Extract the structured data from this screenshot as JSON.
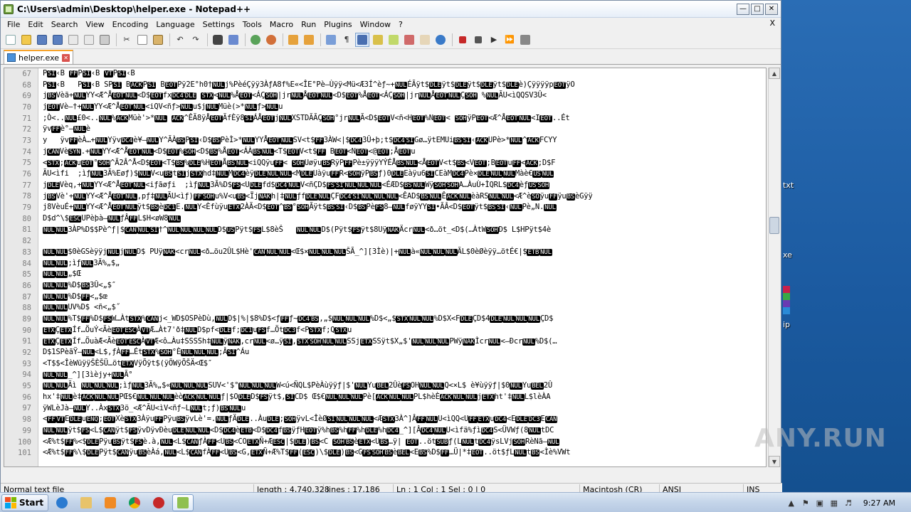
{
  "window": {
    "title": "C:\\Users\\admin\\Desktop\\helper.exe - Notepad++"
  },
  "menu": [
    "File",
    "Edit",
    "Search",
    "View",
    "Encoding",
    "Language",
    "Settings",
    "Tools",
    "Macro",
    "Run",
    "Plugins",
    "Window",
    "?"
  ],
  "menu_close": "X",
  "tab": {
    "label": "helper.exe"
  },
  "lines": [
    {
      "n": "67",
      "t": "PSI‹B FFPSI‹B VTPSI‹B"
    },
    {
      "n": "68",
      "t": "PSI‹B   PSI‹B SPSI BACKPSI BEOTPÿ2E°h0†NULj%PèéÇÿÿ3Àƒ­A8f%E«<ÎE°Pè–Ùÿÿ<Mü<Æ3Í^èƒ~+NULÉÃÿt$DLEÿt$DLEÿt$DLEÿt$DLEè)ÇÿÿÿÿpEOTÿO"
    },
    {
      "n": "69",
      "t": "jBSVèã+NULYY<Æ^ÅEOTNUL<D$EOTfxDC4DLE STX<NUL%ÅEOT<ÁÇSOH|jrNULÅEOTNUL<D$EOT%ÅEOT<ÁÇSOH|jrNULÅEOTNULÇSOH %NULÃU<ìQQSV3Û<"
    },
    {
      "n": "70",
      "t": "jEOTVè–†+NULYY<Æ^ÅEOTNUL<iQV<ñƒ>NULu$jNULMüè(>*NULƒ>NULu"
    },
    {
      "n": "71",
      "t": ";Ò<..NUL£0<..NUL%ACKMüè'>*NUL ACK^ÊÃ8ÿÅEOTÃfÈÿ8SIÁÅEOTjNULXSTDÃÃÇSOH°jrNULÃ<D$EOTV<ñ<HEOT%NEOT< SOHÿPEOT<Æ^ÅEOTNUL<IEOT..Ét"
    },
    {
      "n": "72",
      "t": "ÿvFFè°–NULè"
    },
    {
      "n": "73",
      "t": "y   ÿvFFèÀ…+NULYÿvDC4è¥–NULY^ÃÀBSPSI‹D$BSPèÌ>*NULYYÅEOTNULSV<t$FF3ÀW<|$DC43Û+þ;t$DC4SIGø…ÿtEMUiBSSI‹ACKUPè>*NUL^ACKFCYY"
    },
    {
      "n": "74",
      "t": "jCANVèSYN.+NULYY<Æ^ÅEOTNUL<D$EOT%SOH<D$BS%ÅEOT<ÁÀBSNUL<T$EOTV<t$FF BEOT<NEOT<@EOT;ÅEOTu"
    },
    {
      "n": "75",
      "t": "<STX;ACKuEOT°SOH^Ã2Â^Å<D$EOT<T$BS%DLE%HEOTÅBSNUL<iQQÿuFF< SOHUøÿuBSRÿPFFPè±ÿÿÿYÝÉÅBSNUL<ÅEOTV<t$BS<VEOT;BEOTuFF<ACK;D$F"
    },
    {
      "n": "76",
      "t": "ÃU<ìfi  ;ìƒNUL3Ã%Eøƒ)$NULV<uBStSIjSTXhd‡NULMDC4èÿDLENULNUL<MDLEUàÿuFFR<SOHÿPBSƒ)0DLEEàÿu6SICEàMDC4Pè×DLENULNULMàè€USNUL"
    },
    {
      "n": "77",
      "t": "jDLEVèq,+NULYY<Æ^ÅEOTNUL<iƒãøƒi  ;ìƒNUL3Ã%D$FS<UDLEfd$DC4NULV<ñÇD$FSSINULNULNUL<ÉÆD$BSNULWÿSOHSOHA…ÀuÙ+ÌQRL$DC4èƒUSSOH"
    },
    {
      "n": "78",
      "t": "jBSVè'+NULYY<Æ^ÅEOTNUL,pƒ‡NULÃU<ìƒ)FFSOHu%V<uBS<ÏjNAKh|‡NULƒfDLENULÇFDC4SINULNULNUL<ÊAD$BSNULÊACKNULèàRSNULNUL<Æ^èSOÿuFFÿuBSèGÿÿ"
    },
    {
      "n": "79",
      "t": "j8VèuÉ+NULYY<Æ^ÅEOTNULÿt$BSèDC1E.NULY<ÈfùÿuETX2ÀÃ<D$EOT^BS°SOHÃÿt$BSSI‹D$BSPèFS8–NULføÿYYSI•ÃÂ<D$EOTÿt$BSSI‹NULPè„N.NUL"
    },
    {
      "n": "80",
      "t": "D$d^\\$ESCUPèþà–NULƒÂFFL$H<øW8NUL"
    },
    {
      "n": "81",
      "t": "NULNUL3ÀP%D$$Pè^ƒ|$CANNULSI†^NULNULNULNULD$USPÿt$FSL$8èŠ   NULNULD$(Pÿt$FSÿt$8UÿNAKÄcrNUL<ð…öt_<D$(…ÀtWSOHD$ L$HPÿt$4è"
    },
    {
      "n": "82",
      "t": ""
    },
    {
      "n": "83",
      "t": "NULNUL$0èGSèÿÿjNULjNULD$ PUÿNAK<crNUL<ð…öu2ÛL$Hè'CANNULNUL<Œ$×NULNULNULŠÃ_^][3Ìè)|+NULà«NULNULNULÃL$0èØèÿÿ…ötÉ€|$ETBNUL"
    },
    {
      "n": "84",
      "t": "NULNUL;ìƒNUL3Ã%„$„"
    },
    {
      "n": "85",
      "t": "NULNUL„$Œ"
    },
    {
      "n": "86",
      "t": "NULNUL%D$BS3Û<„$″"
    },
    {
      "n": "87",
      "t": "NULNUL%D$FF<„$œ"
    },
    {
      "n": "88",
      "t": "NULNULUV%D$ <ñ<„$˝"
    },
    {
      "n": "89",
      "t": "NULNUL%T$FF%D$FSW…ÀtSTX%CANj<_WD$OSPèDù,NULD$|%|$8%D$<ƒFFƒ~DC4BS,„$NULNULNUL%D$<„$STXNULNUL%D$X<FDLEÇD$4DLENULNULNULÇD$"
    },
    {
      "n": "90",
      "t": "ETXÇETXÍf…ÖuÝ<ÃèEOTESCÀVTÆ…Àt7'ð‡NULD$pf<DLEf;DC1uFSf…ÖtDC3f<PSTXf;QSTXu"
    },
    {
      "n": "91",
      "t": "ETXÇETXÍf…ÖuàÆ<ÃèEOTESCÀVTÆ<ô…Àu‡SSSSh‡NULÿNAK,crNUL<ø…ÿSI,STXSOHNULNULSSjETXSSÿt$X„$'NULNULNULPWÿNAKÌcrNUL<–ÐcrNUL%D$(…"
    },
    {
      "n": "92",
      "t": "D$1SPèãŸ–NUL<L$,ƒÀFF…ÉtSTX%SOH°ÈNULNULNUL;ÂSI^Áu"
    },
    {
      "n": "93",
      "t": "<T$$<ÎèWüÿÿŠÈŠÜ…ötETXVÿÕÿt$(ÿÕWÿÕŠÄ<Œ$″"
    },
    {
      "n": "94",
      "t": "NULNUL_^][3ìèjy+NULÃ°"
    },
    {
      "n": "95",
      "t": "NULNULÃì NULNULNUL;ìƒNUL3Ã%„$«NULNULNULSUV<'$°NULNULNULW<ú<ÑQL$PèÀùÿÿƒ|$'NULYuBEL2ÛèFSOHNULNULQ<×L$ è¥ùÿÿƒ|$0NULYuBEL2Û"
    },
    {
      "n": "96",
      "t": "hx'‡NULè‡ACKNULNULPŒ$€NULNULNULèòACKNULNULƒ|$ODLED$FSÿt$,SICD$ Œ$€NULNULNULPè[ACKNULNULPL$hèÈACKNULNULjETXht'‡NULL$lèÀA"
    },
    {
      "n": "97",
      "t": "ÿWLèJà–NULY..ÀxSTX3ö_<Æ^ÃU<ìV<ñƒ~LNULt;ƒ)BSNULu"
    },
    {
      "n": "98",
      "t": "<FFVTEDLEuENQ;EOTXèSTX3ÀÿuFFPÿuBSÿvLè'=.NULƒÄDLE..ÀuDLE;SOHÿvL<ÎèØSINULNULNUL<ÆSTX3À^]ÂFFNULU<ìQQ<UFFETXuDC4<EDLEDC3ECAN"
    },
    {
      "n": "99",
      "t": "NULNULÿt$FS<L$CANÿt$FSÿvDÿvÐèuDLENULNUL<D$DC4èETB<D$DC4fBSÿƒHEOTÿ%hBS%hFF%hDLE%hDC4_^][ÂDC4NULU<ìfä%ƒìDC4S<ÜVWƒ(8NULtDC"
    },
    {
      "n": "100",
      "t": "<Æ%t$FF%<$DLEPÿuBSÿt$FSè.à,NUL<L$CANƒÀFF<UBS<COETXÑ+ÆESC|$DLE)BS<C SOHBSèETX<UBS…ÿ| EOT..ötSUBƒ(LNULtDC4ÿsLVjSOHRèNã–NUL"
    },
    {
      "n": "101",
      "t": "<Æ%t$FF%\\$DLEPÿt$CANÿuBSèÀá,NUL<L$CANfÀFF<UBS<G,ETXÑ+Æ%T$FF(ESC)\\$DLE)BS<GFSSOHBSèBEL<EBS%D$FF…Ü|*‡EOT..öt$ƒLNULtBS<Ìè%VWt"
    }
  ],
  "status": {
    "file_type": "Normal text file",
    "length": "length : 4,740,328",
    "lines": "lines : 17,186",
    "position": "Ln : 1    Col : 1    Sel : 0 | 0",
    "eol": "Macintosh (CR)",
    "encoding": "ANSI",
    "mode": "INS"
  },
  "desktop_labels": [
    "txt",
    "xe",
    "ip"
  ],
  "taskbar": {
    "start": "Start",
    "clock": "9:27 AM"
  },
  "watermark": "ANY.RUN",
  "colors": {
    "desktop": "#2a6db5",
    "tab_accent": "#f7a32a",
    "control_char_bg": "#000000"
  }
}
